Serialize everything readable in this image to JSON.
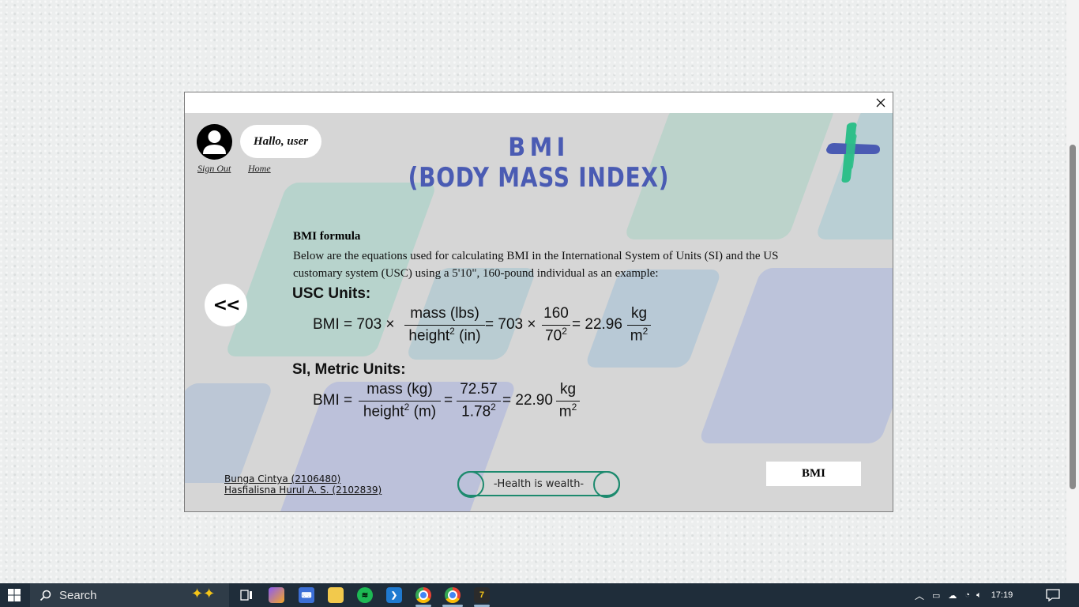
{
  "header": {
    "greeting": "Hallo, user",
    "sign_out": "Sign Out",
    "home": "Home"
  },
  "title": {
    "line1": "BMI",
    "line2": "(BODY MASS INDEX)"
  },
  "formula": {
    "heading": "BMI formula",
    "description": "Below are the equations used for calculating BMI in the International System of Units (SI) and the US customary system (USC) using a 5'10\", 160-pound individual as an example:"
  },
  "usc": {
    "heading": "USC Units:",
    "lhs": "BMI = 703 ×",
    "num1": "mass (lbs)",
    "den1_base": "height",
    "den1_exp": "2",
    "den1_unit": " (in)",
    "mid": "= 703 ×",
    "num2": "160",
    "den2_base": "70",
    "den2_exp": "2",
    "result": "= 22.96",
    "unit_num": "kg",
    "unit_den_base": "m",
    "unit_den_exp": "2"
  },
  "si": {
    "heading": "SI, Metric Units:",
    "lhs": "BMI =",
    "num1": "mass (kg)",
    "den1_base": "height",
    "den1_exp": "2",
    "den1_unit": " (m)",
    "eq1": "=",
    "num2": "72.57",
    "den2_base": "1.78",
    "den2_exp": "2",
    "result": "= 22.90",
    "unit_num": "kg",
    "unit_den_base": "m",
    "unit_den_exp": "2"
  },
  "back_label": "<<",
  "credits": {
    "line1": "Bunga Cintya (2106480)",
    "line2": "Hasfialisna Hurul A. S. (2102839)"
  },
  "motto": "-Health is wealth-",
  "bmi_button": "BMI",
  "taskbar": {
    "search_label": "Search",
    "time": "17:19"
  },
  "colors": {
    "title": "#4a5bb3",
    "logo_green": "#2fbf8a",
    "logo_blue": "#4a5bb3",
    "motto_border": "#1d8a6e"
  }
}
